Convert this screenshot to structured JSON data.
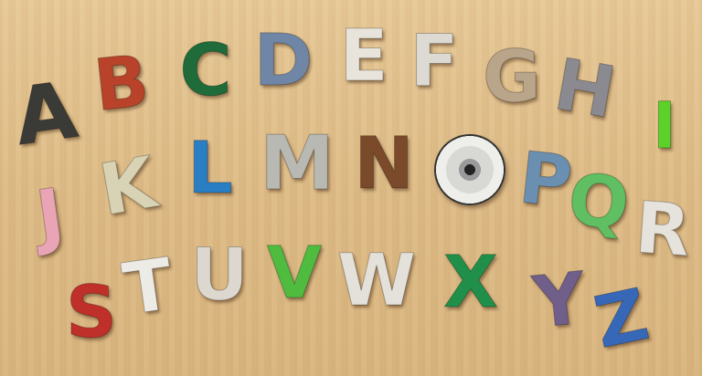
{
  "letters": [
    {
      "char": "A",
      "material": "chain",
      "color": "#3a3a36"
    },
    {
      "char": "B",
      "material": "coiled cable",
      "color": "#b8432a"
    },
    {
      "char": "C",
      "material": "circuit board",
      "color": "#1f6b3a"
    },
    {
      "char": "D",
      "material": "denim",
      "color": "#6f86a6"
    },
    {
      "char": "E",
      "material": "newspaper",
      "color": "#e8e4dc"
    },
    {
      "char": "F",
      "material": "paper",
      "color": "#dcdad2"
    },
    {
      "char": "G",
      "material": "cardboard",
      "color": "#b9a58a"
    },
    {
      "char": "H",
      "material": "cables",
      "color": "#8a8a90"
    },
    {
      "char": "I",
      "material": "plastic rings",
      "color": "#5bd12a"
    },
    {
      "char": "J",
      "material": "hair curlers",
      "color": "#e9a5b5"
    },
    {
      "char": "K",
      "material": "keyboard keys",
      "color": "#d9d3b5"
    },
    {
      "char": "L",
      "material": "markers",
      "color": "#2a7fc4"
    },
    {
      "char": "M",
      "material": "blister packs",
      "color": "#b9b9b4"
    },
    {
      "char": "N",
      "material": "necktie",
      "color": "#7a4a2a"
    },
    {
      "char": "O",
      "material": "compact disc",
      "color": "#d8d8d4"
    },
    {
      "char": "P",
      "material": "photo",
      "color": "#6a8fb0"
    },
    {
      "char": "Q",
      "material": "foam",
      "color": "#5fbf62"
    },
    {
      "char": "R",
      "material": "map",
      "color": "#e5e3dc"
    },
    {
      "char": "S",
      "material": "bike chain",
      "color": "#c0302a"
    },
    {
      "char": "T",
      "material": "paper",
      "color": "#ecebe6"
    },
    {
      "char": "U",
      "material": "cardboard",
      "color": "#dcd8d0"
    },
    {
      "char": "V",
      "material": "feathers",
      "color": "#4fbb3f"
    },
    {
      "char": "W",
      "material": "paper",
      "color": "#e4e1da"
    },
    {
      "char": "X",
      "material": "bottle caps",
      "color": "#1f8f4a"
    },
    {
      "char": "Y",
      "material": "fabric",
      "color": "#6f5f8a"
    },
    {
      "char": "Z",
      "material": "zipper",
      "color": "#3768b8"
    }
  ]
}
